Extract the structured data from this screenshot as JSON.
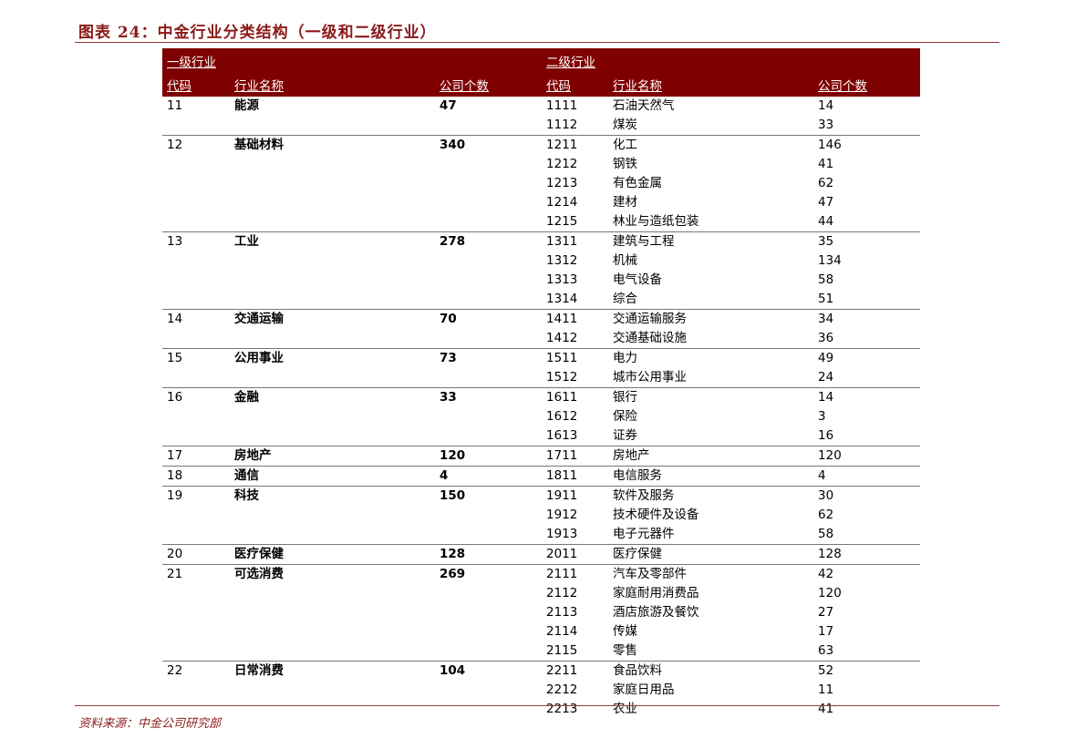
{
  "title": "图表 24：中金行业分类结构（一级和二级行业）",
  "source": "资料来源：中金公司研究部",
  "header": {
    "level1": "一级行业",
    "level2": "二级行业",
    "code": "代码",
    "name": "行业名称",
    "count": "公司个数"
  },
  "groups": [
    {
      "code": "11",
      "name": "能源",
      "count": "47",
      "subs": [
        [
          "1111",
          "石油天然气",
          "14"
        ],
        [
          "1112",
          "煤炭",
          "33"
        ]
      ]
    },
    {
      "code": "12",
      "name": "基础材料",
      "count": "340",
      "subs": [
        [
          "1211",
          "化工",
          "146"
        ],
        [
          "1212",
          "钢铁",
          "41"
        ],
        [
          "1213",
          "有色金属",
          "62"
        ],
        [
          "1214",
          "建材",
          "47"
        ],
        [
          "1215",
          "林业与造纸包装",
          "44"
        ]
      ]
    },
    {
      "code": "13",
      "name": "工业",
      "count": "278",
      "subs": [
        [
          "1311",
          "建筑与工程",
          "35"
        ],
        [
          "1312",
          "机械",
          "134"
        ],
        [
          "1313",
          "电气设备",
          "58"
        ],
        [
          "1314",
          "综合",
          "51"
        ]
      ]
    },
    {
      "code": "14",
      "name": "交通运输",
      "count": "70",
      "subs": [
        [
          "1411",
          "交通运输服务",
          "34"
        ],
        [
          "1412",
          "交通基础设施",
          "36"
        ]
      ]
    },
    {
      "code": "15",
      "name": "公用事业",
      "count": "73",
      "subs": [
        [
          "1511",
          "电力",
          "49"
        ],
        [
          "1512",
          "城市公用事业",
          "24"
        ]
      ]
    },
    {
      "code": "16",
      "name": "金融",
      "count": "33",
      "subs": [
        [
          "1611",
          "银行",
          "14"
        ],
        [
          "1612",
          "保险",
          "3"
        ],
        [
          "1613",
          "证券",
          "16"
        ]
      ]
    },
    {
      "code": "17",
      "name": "房地产",
      "count": "120",
      "subs": [
        [
          "1711",
          "房地产",
          "120"
        ]
      ]
    },
    {
      "code": "18",
      "name": "通信",
      "count": "4",
      "subs": [
        [
          "1811",
          "电信服务",
          "4"
        ]
      ]
    },
    {
      "code": "19",
      "name": "科技",
      "count": "150",
      "subs": [
        [
          "1911",
          "软件及服务",
          "30"
        ],
        [
          "1912",
          "技术硬件及设备",
          "62"
        ],
        [
          "1913",
          "电子元器件",
          "58"
        ]
      ]
    },
    {
      "code": "20",
      "name": "医疗保健",
      "count": "128",
      "subs": [
        [
          "2011",
          "医疗保健",
          "128"
        ]
      ]
    },
    {
      "code": "21",
      "name": "可选消费",
      "count": "269",
      "subs": [
        [
          "2111",
          "汽车及零部件",
          "42"
        ],
        [
          "2112",
          "家庭耐用消费品",
          "120"
        ],
        [
          "2113",
          "酒店旅游及餐饮",
          "27"
        ],
        [
          "2114",
          "传媒",
          "17"
        ],
        [
          "2115",
          "零售",
          "63"
        ]
      ]
    },
    {
      "code": "22",
      "name": "日常消费",
      "count": "104",
      "subs": [
        [
          "2211",
          "食品饮料",
          "52"
        ],
        [
          "2212",
          "家庭日用品",
          "11"
        ],
        [
          "2213",
          "农业",
          "41"
        ]
      ]
    }
  ]
}
